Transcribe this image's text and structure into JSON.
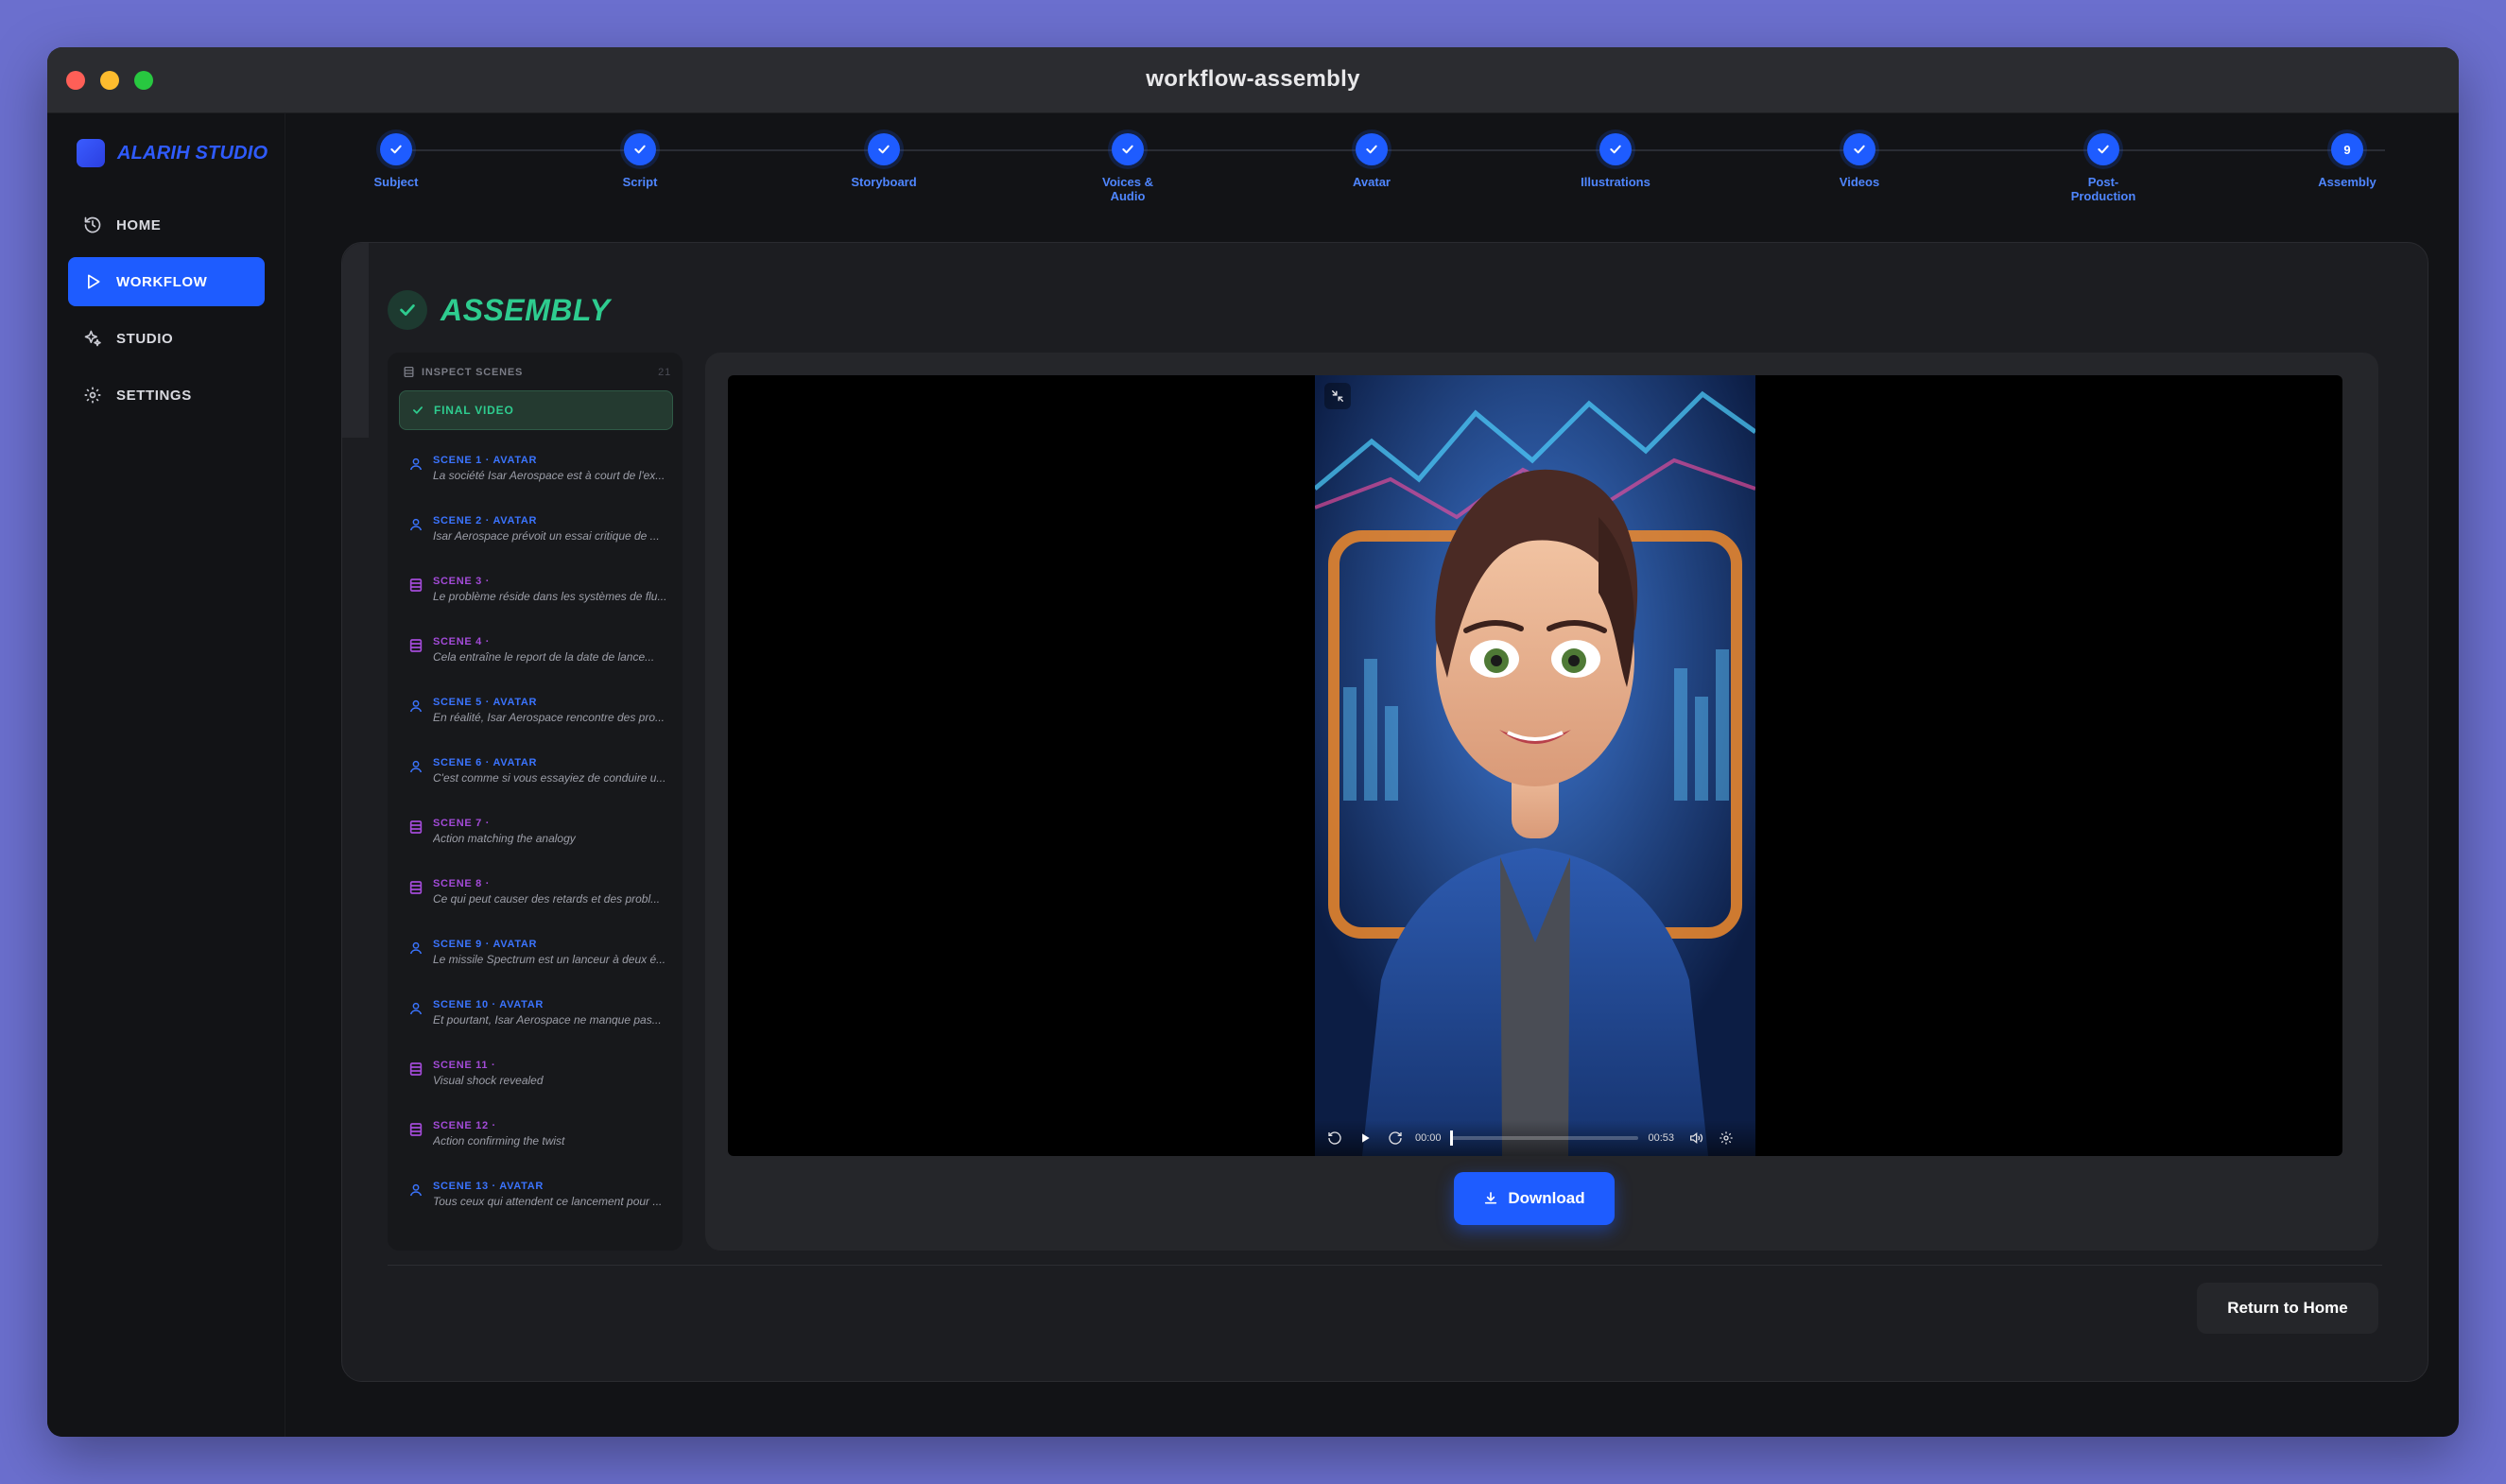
{
  "window": {
    "title": "workflow-assembly"
  },
  "brand": {
    "name": "ALARIH STUDIO"
  },
  "nav": {
    "items": [
      {
        "label": "HOME",
        "icon": "history-icon",
        "active": false
      },
      {
        "label": "WORKFLOW",
        "icon": "play-icon",
        "active": true
      },
      {
        "label": "STUDIO",
        "icon": "sparkles-icon",
        "active": false
      },
      {
        "label": "SETTINGS",
        "icon": "gear-icon",
        "active": false
      }
    ]
  },
  "stepper": {
    "steps": [
      {
        "label": "Subject",
        "state": "done"
      },
      {
        "label": "Script",
        "state": "done"
      },
      {
        "label": "Storyboard",
        "state": "done"
      },
      {
        "label": "Voices &\nAudio",
        "state": "done"
      },
      {
        "label": "Avatar",
        "state": "done"
      },
      {
        "label": "Illustrations",
        "state": "done"
      },
      {
        "label": "Videos",
        "state": "done"
      },
      {
        "label": "Post-\nProduction",
        "state": "done"
      },
      {
        "label": "Assembly",
        "state": "current",
        "number": "9"
      }
    ]
  },
  "assembly": {
    "title": "ASSEMBLY"
  },
  "scenes": {
    "header": "INSPECT SCENES",
    "count": "21",
    "final_label": "FINAL VIDEO",
    "items": [
      {
        "label": "SCENE 1 · AVATAR",
        "type": "avatar",
        "desc": "La société Isar Aerospace est à court de l'ex..."
      },
      {
        "label": "SCENE 2 · AVATAR",
        "type": "avatar",
        "desc": "Isar Aerospace prévoit un essai critique de ..."
      },
      {
        "label": "SCENE 3 ·",
        "type": "visual",
        "desc": "Le problème réside dans les systèmes de flu..."
      },
      {
        "label": "SCENE 4 ·",
        "type": "visual",
        "desc": "Cela entraîne le report de la date de lance..."
      },
      {
        "label": "SCENE 5 · AVATAR",
        "type": "avatar",
        "desc": "En réalité, Isar Aerospace rencontre des pro..."
      },
      {
        "label": "SCENE 6 · AVATAR",
        "type": "avatar",
        "desc": "C'est comme si vous essayiez de conduire u..."
      },
      {
        "label": "SCENE 7 ·",
        "type": "visual",
        "desc": "Action matching the analogy"
      },
      {
        "label": "SCENE 8 ·",
        "type": "visual",
        "desc": "Ce qui peut causer des retards et des probl..."
      },
      {
        "label": "SCENE 9 · AVATAR",
        "type": "avatar",
        "desc": "Le missile Spectrum est un lanceur à deux é..."
      },
      {
        "label": "SCENE 10 · AVATAR",
        "type": "avatar",
        "desc": "Et pourtant, Isar Aerospace ne manque pas..."
      },
      {
        "label": "SCENE 11 ·",
        "type": "visual",
        "desc": "Visual shock revealed"
      },
      {
        "label": "SCENE 12 ·",
        "type": "visual",
        "desc": "Action confirming the twist"
      },
      {
        "label": "SCENE 13 · AVATAR",
        "type": "avatar",
        "desc": "Tous ceux qui attendent ce lancement pour ..."
      }
    ]
  },
  "player": {
    "current_time": "00:00",
    "duration": "00:53",
    "progress": 0.0
  },
  "actions": {
    "download_label": "Download",
    "return_label": "Return to Home"
  },
  "colors": {
    "accent": "#1e5cff",
    "success": "#2ecc8f",
    "avatar_label": "#3b74ff",
    "visual_label": "#a34bd8",
    "background": "#6b6fce"
  }
}
